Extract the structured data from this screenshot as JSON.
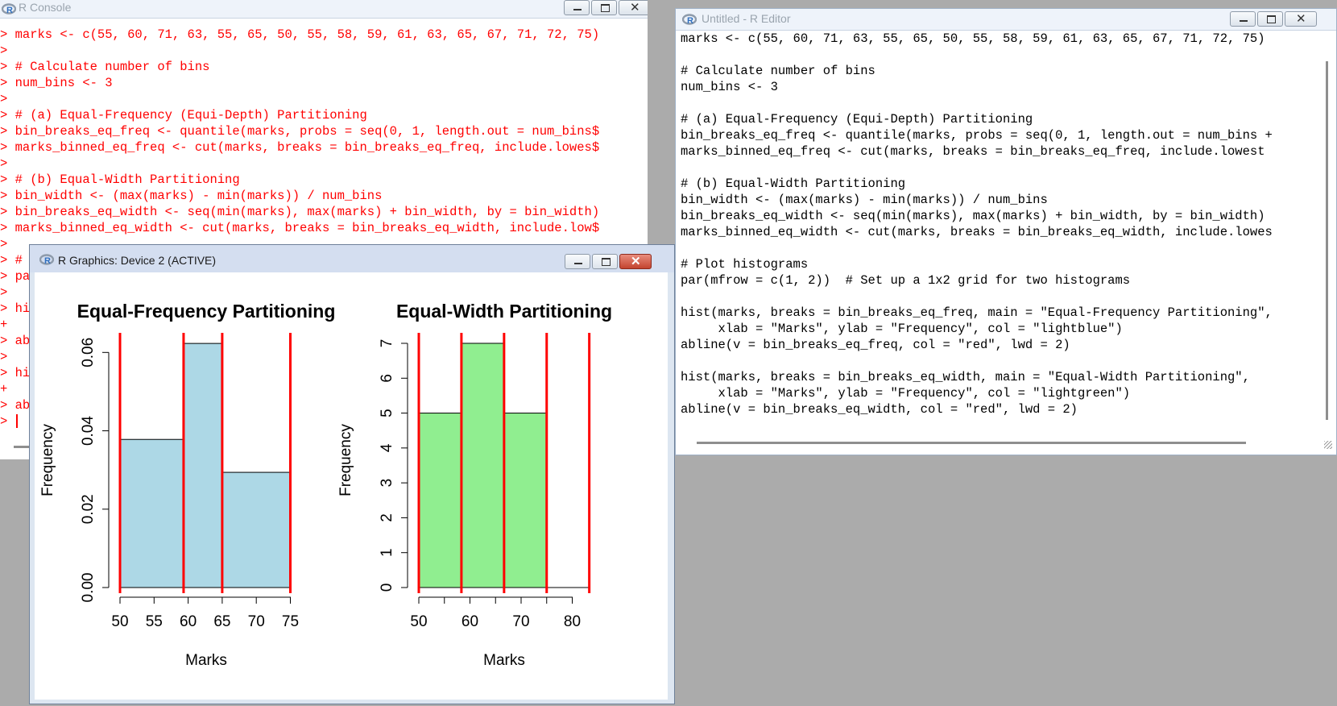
{
  "console": {
    "title": "R Console",
    "lines": [
      "> marks <- c(55, 60, 71, 63, 55, 65, 50, 55, 58, 59, 61, 63, 65, 67, 71, 72, 75)",
      ">",
      "> # Calculate number of bins",
      "> num_bins <- 3",
      ">",
      "> # (a) Equal-Frequency (Equi-Depth) Partitioning",
      "> bin_breaks_eq_freq <- quantile(marks, probs = seq(0, 1, length.out = num_bins$",
      "> marks_binned_eq_freq <- cut(marks, breaks = bin_breaks_eq_freq, include.lowes$",
      ">",
      "> # (b) Equal-Width Partitioning",
      "> bin_width <- (max(marks) - min(marks)) / num_bins",
      "> bin_breaks_eq_width <- seq(min(marks), max(marks) + bin_width, by = bin_width)",
      "> marks_binned_eq_width <- cut(marks, breaks = bin_breaks_eq_width, include.low$",
      ">",
      "> #",
      "> pa",
      ">",
      "> hi",
      "+",
      "> ab",
      ">",
      "> hi",
      "+",
      "> ab",
      ">"
    ]
  },
  "editor": {
    "title": "Untitled - R Editor",
    "lines": [
      "marks <- c(55, 60, 71, 63, 55, 65, 50, 55, 58, 59, 61, 63, 65, 67, 71, 72, 75)",
      "",
      "# Calculate number of bins",
      "num_bins <- 3",
      "",
      "# (a) Equal-Frequency (Equi-Depth) Partitioning",
      "bin_breaks_eq_freq <- quantile(marks, probs = seq(0, 1, length.out = num_bins +",
      "marks_binned_eq_freq <- cut(marks, breaks = bin_breaks_eq_freq, include.lowest",
      "",
      "# (b) Equal-Width Partitioning",
      "bin_width <- (max(marks) - min(marks)) / num_bins",
      "bin_breaks_eq_width <- seq(min(marks), max(marks) + bin_width, by = bin_width)",
      "marks_binned_eq_width <- cut(marks, breaks = bin_breaks_eq_width, include.lowes",
      "",
      "# Plot histograms",
      "par(mfrow = c(1, 2))  # Set up a 1x2 grid for two histograms",
      "",
      "hist(marks, breaks = bin_breaks_eq_freq, main = \"Equal-Frequency Partitioning\",",
      "     xlab = \"Marks\", ylab = \"Frequency\", col = \"lightblue\")",
      "abline(v = bin_breaks_eq_freq, col = \"red\", lwd = 2)",
      "",
      "hist(marks, breaks = bin_breaks_eq_width, main = \"Equal-Width Partitioning\",",
      "     xlab = \"Marks\", ylab = \"Frequency\", col = \"lightgreen\")",
      "abline(v = bin_breaks_eq_width, col = \"red\", lwd = 2)"
    ]
  },
  "graphics": {
    "title": "R Graphics: Device 2 (ACTIVE)"
  },
  "window_icons": [
    "r-logo-icon",
    "minimize-icon",
    "maximize-icon",
    "close-icon"
  ],
  "colors": {
    "console_text": "#ff0000",
    "abline": "#ff0000",
    "lightblue": "#add8e6",
    "lightgreen": "#90ee90",
    "desktop": "#ababab"
  },
  "chart_data": [
    {
      "type": "bar",
      "title": "Equal-Frequency Partitioning",
      "xlabel": "Marks",
      "ylabel": "Frequency",
      "bins": [
        [
          50,
          59.33
        ],
        [
          59.33,
          65
        ],
        [
          65,
          75
        ]
      ],
      "values": [
        0.0378,
        0.0623,
        0.0294
      ],
      "ablines": [
        50,
        59.33,
        65,
        75
      ],
      "xlim": [
        50,
        75
      ],
      "ylim": [
        0,
        0.065
      ],
      "xticks": [
        50,
        55,
        60,
        65,
        70,
        75
      ],
      "yticks": [
        0.0,
        0.02,
        0.04,
        0.06
      ],
      "ytick_labels": [
        "0.00",
        "0.02",
        "0.04",
        "0.06"
      ],
      "bar_color": "#add8e6",
      "abline_color": "#ff0000"
    },
    {
      "type": "bar",
      "title": "Equal-Width Partitioning",
      "xlabel": "Marks",
      "ylabel": "Frequency",
      "bins": [
        [
          50,
          58.33
        ],
        [
          58.33,
          66.67
        ],
        [
          66.67,
          75
        ],
        [
          75,
          83.33
        ]
      ],
      "values": [
        5,
        7,
        5,
        0
      ],
      "ablines": [
        50,
        58.33,
        66.67,
        75,
        83.33
      ],
      "xlim": [
        50,
        83.33
      ],
      "ylim": [
        0,
        7.3
      ],
      "xticks": [
        50,
        60,
        70,
        80
      ],
      "xminor": [
        55,
        65,
        75
      ],
      "yticks": [
        0,
        1,
        2,
        3,
        4,
        5,
        6,
        7
      ],
      "ytick_labels": [
        "0",
        "1",
        "2",
        "3",
        "4",
        "5",
        "6",
        "7"
      ],
      "bar_color": "#90ee90",
      "abline_color": "#ff0000"
    }
  ]
}
